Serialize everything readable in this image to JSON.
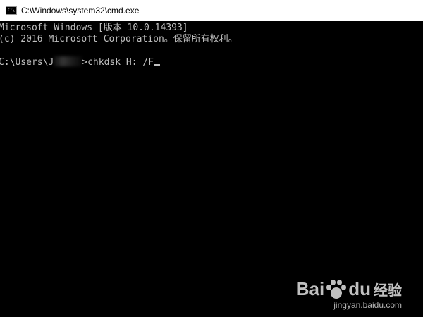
{
  "window": {
    "title": "C:\\Windows\\system32\\cmd.exe"
  },
  "console": {
    "lines": [
      "Microsoft Windows [版本 10.0.14393]",
      "(c) 2016 Microsoft Corporation。保留所有权利。"
    ],
    "prompt_prefix": "C:\\Users\\J",
    "prompt_suffix": ">",
    "command": "chkdsk H: /F"
  },
  "watermark": {
    "logo_text_left": "Bai",
    "logo_text_right": "du",
    "logo_text_cn": "经验",
    "url": "jingyan.baidu.com"
  },
  "colors": {
    "console_background": "#000000",
    "console_text": "#c0c0c0",
    "titlebar_background": "#ffffff"
  }
}
